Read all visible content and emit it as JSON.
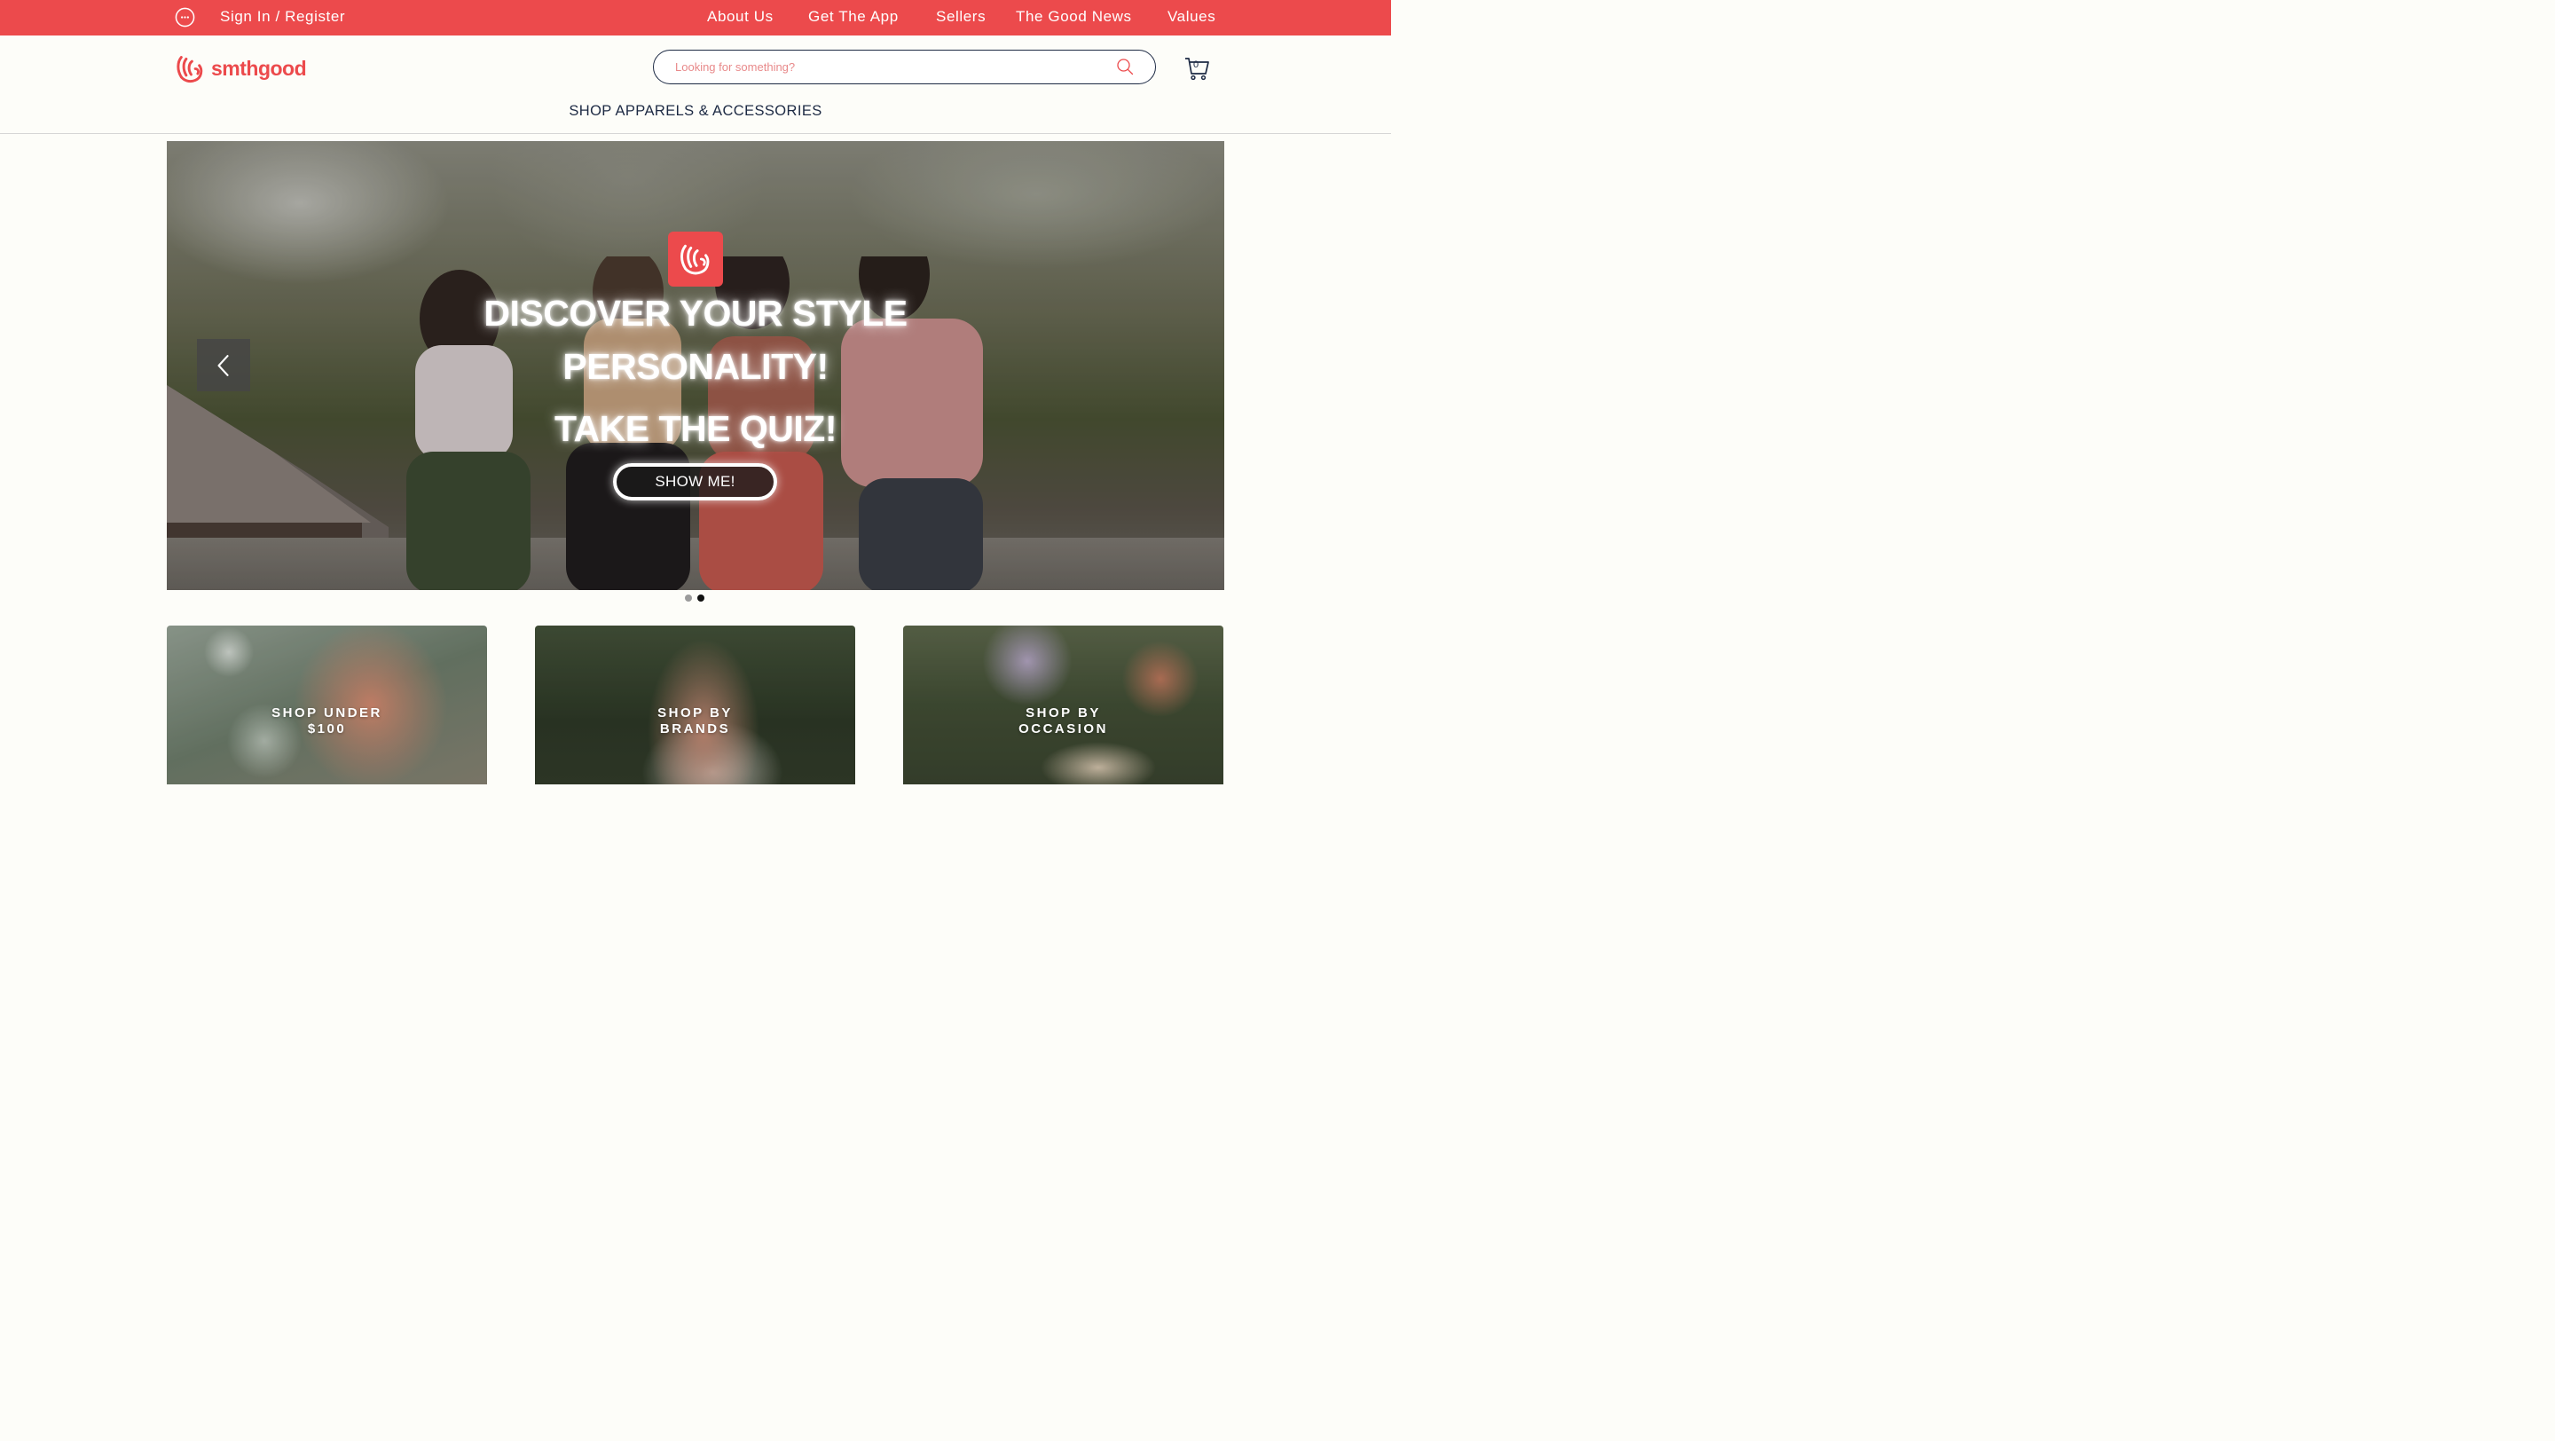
{
  "topbar": {
    "signin_label": "Sign In / Register",
    "nav": [
      "About Us",
      "Get The App",
      "Sellers",
      "The Good News",
      "Values"
    ],
    "background_color": "#ec4a4c"
  },
  "header": {
    "brand_name": "smthgood",
    "brand_color": "#ec4a4c",
    "search_placeholder": "Looking for something?",
    "cart_count": "0",
    "category_nav": "SHOP APPARELS & ACCESSORIES"
  },
  "hero": {
    "headline_line1": "DISCOVER YOUR STYLE",
    "headline_line2": "PERSONALITY!",
    "headline_line3": "TAKE THE QUIZ!",
    "cta_label": "SHOW ME!",
    "slide_count": 2,
    "active_slide": 2
  },
  "categories": [
    {
      "line1": "SHOP UNDER",
      "line2": "$100"
    },
    {
      "line1": "SHOP BY",
      "line2": "BRANDS"
    },
    {
      "line1": "SHOP BY",
      "line2": "OCCASION"
    }
  ],
  "icons": {
    "user": "user-circle-icon",
    "search": "search-icon",
    "cart": "cart-icon",
    "prev": "chevron-left-icon",
    "logo": "smthgood-hand-logo"
  }
}
